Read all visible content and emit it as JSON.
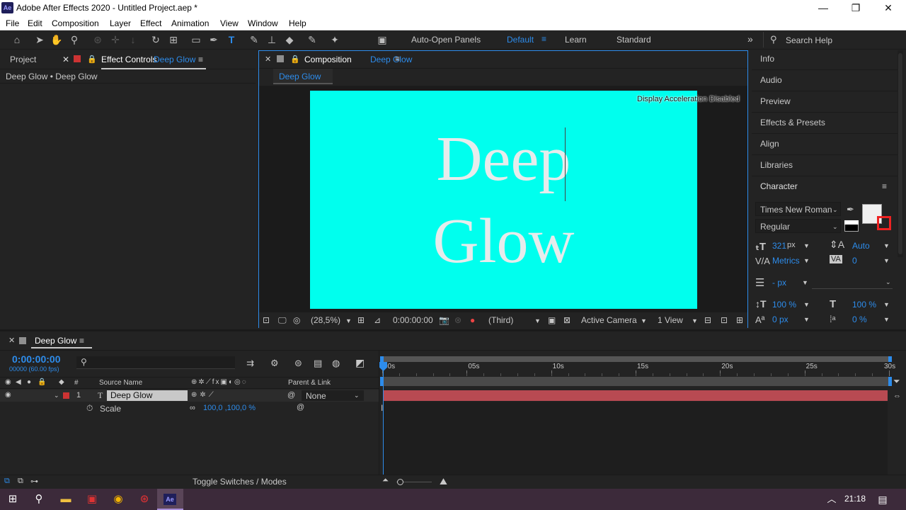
{
  "window": {
    "title": "Adobe After Effects 2020 - Untitled Project.aep *",
    "logo": "Ae",
    "minimize": "—",
    "maximize": "❐",
    "close": "✕"
  },
  "menu": [
    "File",
    "Edit",
    "Composition",
    "Layer",
    "Effect",
    "Animation",
    "View",
    "Window",
    "Help"
  ],
  "toolbar": {
    "auto_open": "Auto-Open Panels",
    "workspaces": [
      "Default",
      "Learn",
      "Standard"
    ],
    "search_placeholder": "Search Help",
    "more": "»"
  },
  "left_panel": {
    "tab_project": "Project",
    "tab_effect_controls": "Effect Controls",
    "tab_effect_controls_target": "Deep Glow",
    "breadcrumb": "Deep Glow • Deep Glow"
  },
  "comp_panel": {
    "tab_label": "Composition",
    "tab_target": "Deep Glow",
    "sub_tab": "Deep Glow",
    "overlay_notice": "Display Acceleration Disabled",
    "canvas_bg": "#00ffee",
    "text_line1": "Deep",
    "text_line2": "Glow",
    "zoom": "(28,5%)",
    "timecode": "0:00:00:00",
    "resolution": "(Third)",
    "camera": "Active Camera",
    "view": "1 View"
  },
  "right_panel": {
    "items": [
      "Info",
      "Audio",
      "Preview",
      "Effects & Presets",
      "Align",
      "Libraries"
    ],
    "character": {
      "title": "Character",
      "font": "Times New Roman",
      "style": "Regular",
      "size": "321",
      "size_unit": "px",
      "leading": "Auto",
      "kerning": "Metrics",
      "tracking": "0",
      "stroke_unit": "- px",
      "vscale": "100 %",
      "hscale": "100 %",
      "baseline": "0 px",
      "tsume": "0 %"
    }
  },
  "timeline": {
    "tab": "Deep Glow",
    "timecode": "0:00:00:00",
    "frames": "00000 (60.00 fps)",
    "search_placeholder": "",
    "col_source": "Source Name",
    "col_parent": "Parent & Link",
    "ruler": [
      "00s",
      "05s",
      "10s",
      "15s",
      "20s",
      "25s",
      "30s"
    ],
    "layer": {
      "index": "1",
      "type": "T",
      "name": "Deep Glow",
      "parent": "None"
    },
    "property": {
      "name": "Scale",
      "value": "100,0 ,100,0 %"
    },
    "bar_color": "#b84a52",
    "toggle": "Toggle Switches / Modes"
  },
  "taskbar": {
    "time": "21:18",
    "app": "Ae"
  }
}
